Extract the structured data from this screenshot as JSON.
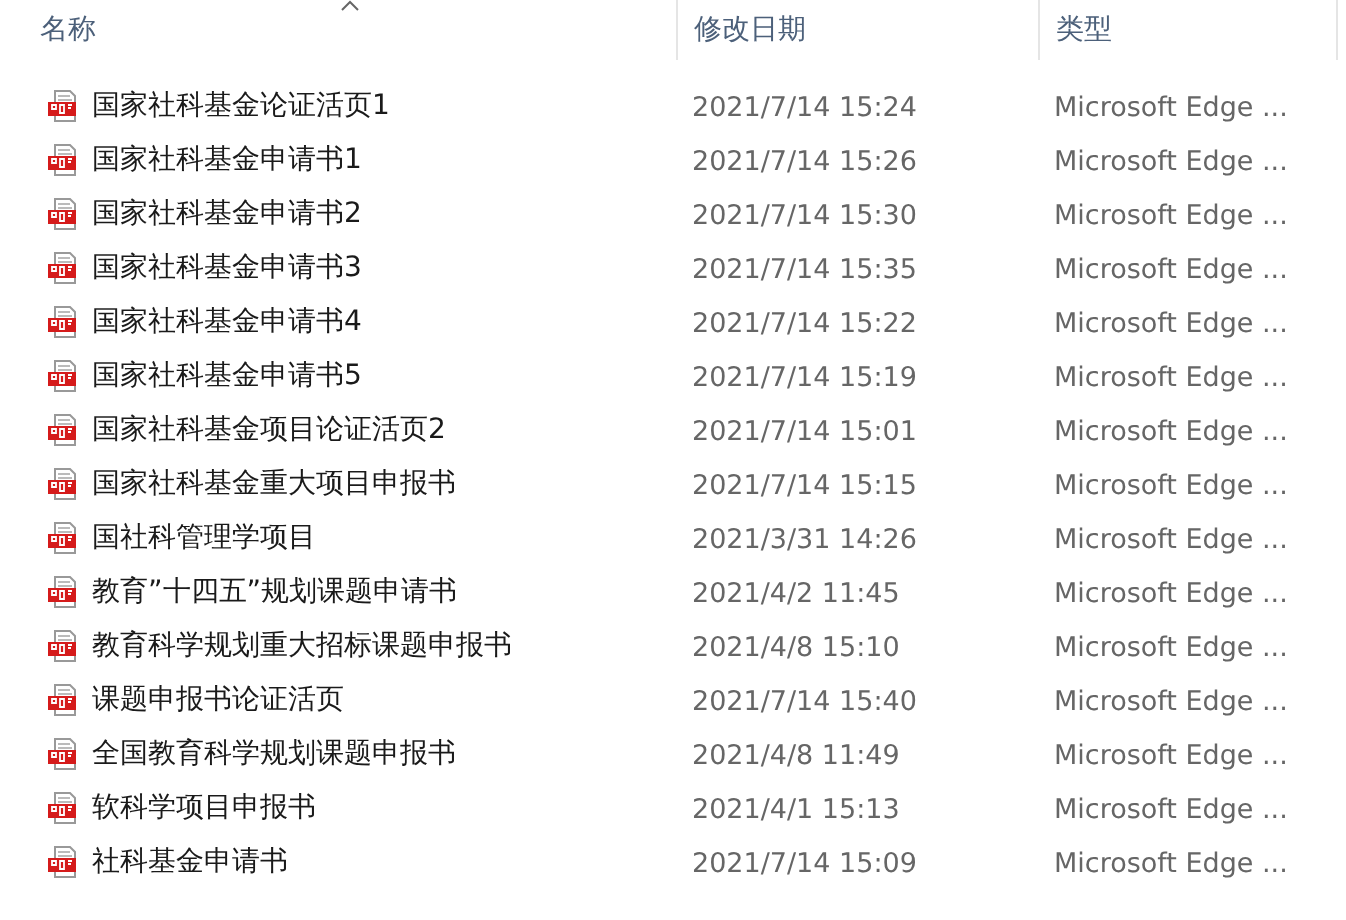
{
  "columns": [
    {
      "label": "名称",
      "sorted": true
    },
    {
      "label": "修改日期",
      "sorted": false
    },
    {
      "label": "类型",
      "sorted": false
    }
  ],
  "rows": [
    {
      "name": "国家社科基金论证活页1",
      "modified": "2021/7/14 15:24",
      "type": "Microsoft Edge ..."
    },
    {
      "name": "国家社科基金申请书1",
      "modified": "2021/7/14 15:26",
      "type": "Microsoft Edge ..."
    },
    {
      "name": "国家社科基金申请书2",
      "modified": "2021/7/14 15:30",
      "type": "Microsoft Edge ..."
    },
    {
      "name": "国家社科基金申请书3",
      "modified": "2021/7/14 15:35",
      "type": "Microsoft Edge ..."
    },
    {
      "name": "国家社科基金申请书4",
      "modified": "2021/7/14 15:22",
      "type": "Microsoft Edge ..."
    },
    {
      "name": "国家社科基金申请书5",
      "modified": "2021/7/14 15:19",
      "type": "Microsoft Edge ..."
    },
    {
      "name": "国家社科基金项目论证活页2",
      "modified": "2021/7/14 15:01",
      "type": "Microsoft Edge ..."
    },
    {
      "name": "国家社科基金重大项目申报书",
      "modified": "2021/7/14 15:15",
      "type": "Microsoft Edge ..."
    },
    {
      "name": "国社科管理学项目",
      "modified": "2021/3/31 14:26",
      "type": "Microsoft Edge ..."
    },
    {
      "name": "教育”十四五”规划课题申请书",
      "modified": "2021/4/2 11:45",
      "type": "Microsoft Edge ..."
    },
    {
      "name": "教育科学规划重大招标课题申报书",
      "modified": "2021/4/8 15:10",
      "type": "Microsoft Edge ..."
    },
    {
      "name": "课题申报书论证活页",
      "modified": "2021/7/14 15:40",
      "type": "Microsoft Edge ..."
    },
    {
      "name": "全国教育科学规划课题申报书",
      "modified": "2021/4/8 11:49",
      "type": "Microsoft Edge ..."
    },
    {
      "name": "软科学项目申报书",
      "modified": "2021/4/1 15:13",
      "type": "Microsoft Edge ..."
    },
    {
      "name": "社科基金申请书",
      "modified": "2021/7/14 15:09",
      "type": "Microsoft Edge ..."
    }
  ]
}
